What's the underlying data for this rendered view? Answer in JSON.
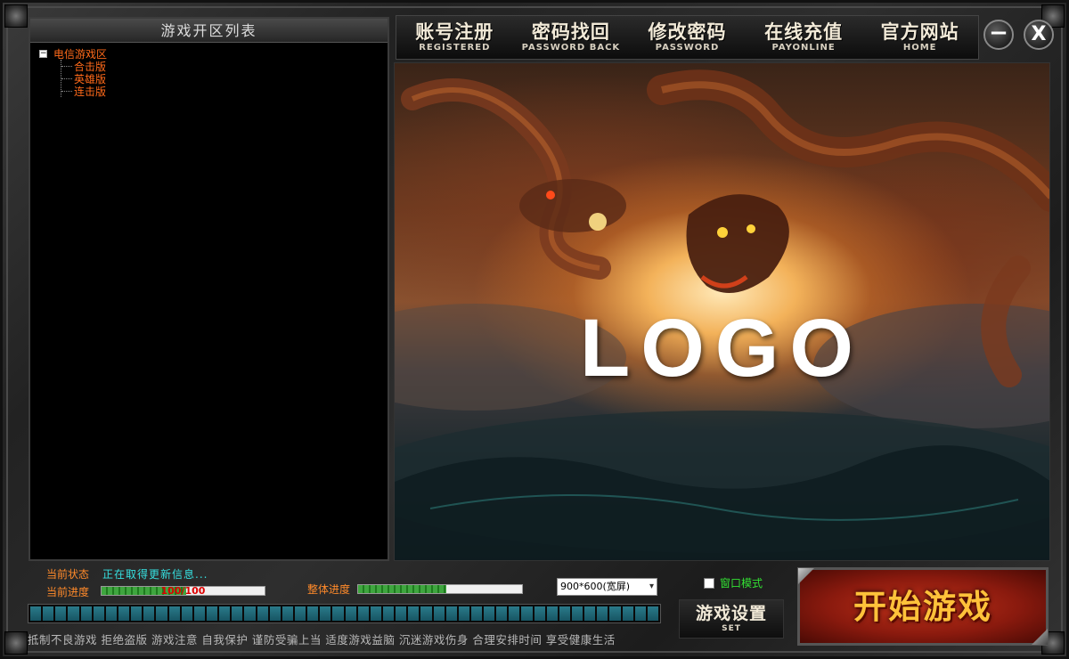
{
  "server_list": {
    "title": "游戏开区列表",
    "root": {
      "toggle": "−",
      "label": "电信游戏区"
    },
    "children": [
      "合击版",
      "英雄版",
      "连击版"
    ]
  },
  "nav": [
    {
      "cn": "账号注册",
      "en": "REGISTERED"
    },
    {
      "cn": "密码找回",
      "en": "PASSWORD BACK"
    },
    {
      "cn": "修改密码",
      "en": "PASSWORD"
    },
    {
      "cn": "在线充值",
      "en": "PAYONLINE"
    },
    {
      "cn": "官方网站",
      "en": "HOME"
    }
  ],
  "window_controls": {
    "minimize": "−",
    "close": "X"
  },
  "banner": {
    "logo": "LOGO"
  },
  "status": {
    "label": "当前状态",
    "text": "正在取得更新信息..."
  },
  "current_progress": {
    "label": "当前进度",
    "text": "100/100",
    "fraction": 0.52
  },
  "overall_progress": {
    "label": "整体进度",
    "fraction": 0.54
  },
  "resolution": {
    "selected": "900*600(宽屏)",
    "arrow": "▾"
  },
  "window_mode": {
    "label": "窗口模式",
    "checked": false
  },
  "slogan": "抵制不良游戏  拒绝盗版  游戏注意  自我保护  谨防受骗上当  适度游戏益脑  沉迷游戏伤身  合理安排时间  享受健康生活",
  "settings": {
    "cn": "游戏设置",
    "en": "SET"
  },
  "start": {
    "label": "开始游戏"
  },
  "colors": {
    "accent_orange": "#ff6a1a",
    "status_cyan": "#36e0e0",
    "window_mode_green": "#33e133",
    "start_gold": "#ffc23a",
    "segment_teal": "#2a7a8a"
  }
}
